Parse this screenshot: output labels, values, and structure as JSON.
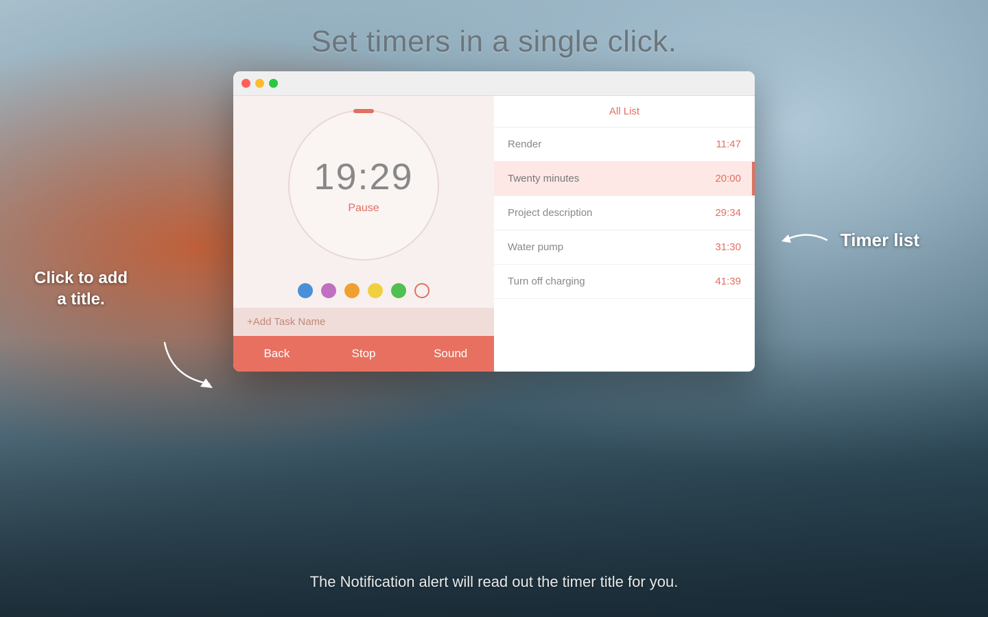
{
  "headline": "Set timers in a single click.",
  "annotation_left": "Click to add\na title.",
  "annotation_right": "Timer list",
  "footer_text": "The Notification alert will read out the timer title for you.",
  "window": {
    "traffic_lights": [
      {
        "color": "#ff5f57",
        "label": "close"
      },
      {
        "color": "#febc2e",
        "label": "minimize"
      },
      {
        "color": "#28c840",
        "label": "maximize"
      }
    ],
    "timer": {
      "time": "19:29",
      "pause_label": "Pause"
    },
    "color_dots": [
      {
        "color": "#4a90d9",
        "type": "filled"
      },
      {
        "color": "#c070c0",
        "type": "filled"
      },
      {
        "color": "#f0a030",
        "type": "filled"
      },
      {
        "color": "#f0d040",
        "type": "filled"
      },
      {
        "color": "#50c050",
        "type": "filled"
      },
      {
        "color": "transparent",
        "type": "empty"
      }
    ],
    "add_task_label": "+Add Task Name",
    "buttons": [
      {
        "label": "Back",
        "id": "back"
      },
      {
        "label": "Stop",
        "id": "stop"
      },
      {
        "label": "Sound",
        "id": "sound"
      }
    ],
    "list": {
      "header": "All List",
      "items": [
        {
          "name": "Render",
          "time": "11:47",
          "active": false
        },
        {
          "name": "Twenty minutes",
          "time": "20:00",
          "active": true
        },
        {
          "name": "Project description",
          "time": "29:34",
          "active": false
        },
        {
          "name": "Water pump",
          "time": "31:30",
          "active": false
        },
        {
          "name": "Turn off charging",
          "time": "41:39",
          "active": false
        }
      ]
    }
  }
}
